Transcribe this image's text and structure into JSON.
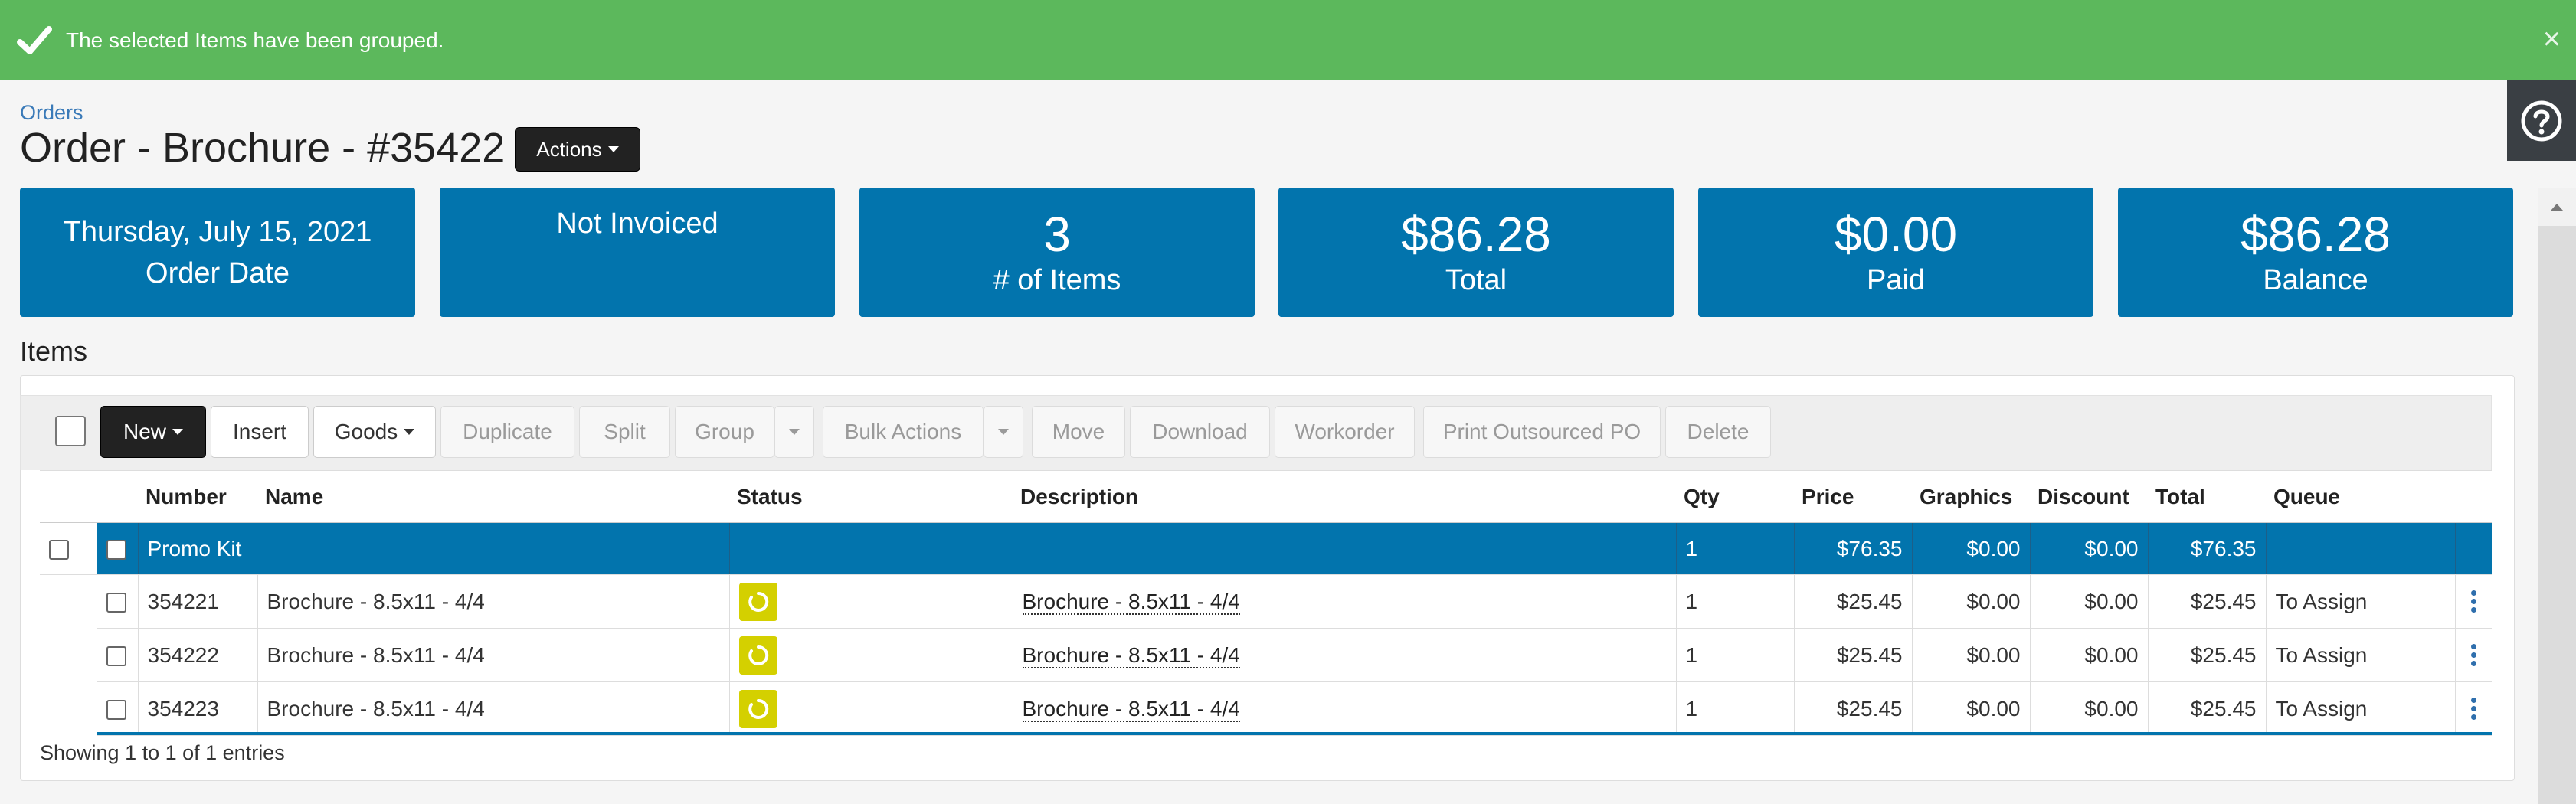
{
  "alert": {
    "message": "The selected Items have been grouped.",
    "close": "×"
  },
  "breadcrumb": "Orders",
  "title": "Order - Brochure - #35422",
  "actions_label": "Actions",
  "cards": [
    {
      "line1": "Thursday, July 15, 2021",
      "line2": "Order Date"
    },
    {
      "line1": "Not Invoiced"
    },
    {
      "value": "3",
      "label": "# of Items"
    },
    {
      "value": "$86.28",
      "label": "Total"
    },
    {
      "value": "$0.00",
      "label": "Paid"
    },
    {
      "value": "$86.28",
      "label": "Balance"
    }
  ],
  "items_title": "Items",
  "toolbar": {
    "new": "New",
    "insert": "Insert",
    "goods": "Goods",
    "duplicate": "Duplicate",
    "split": "Split",
    "group": "Group",
    "bulk_actions": "Bulk Actions",
    "move": "Move",
    "download": "Download",
    "workorder": "Workorder",
    "print_po": "Print Outsourced PO",
    "delete": "Delete"
  },
  "columns": {
    "number": "Number",
    "name": "Name",
    "status": "Status",
    "description": "Description",
    "qty": "Qty",
    "price": "Price",
    "graphics": "Graphics",
    "discount": "Discount",
    "total": "Total",
    "queue": "Queue"
  },
  "group_row": {
    "name": "Promo Kit",
    "qty": "1",
    "price": "$76.35",
    "graphics": "$0.00",
    "discount": "$0.00",
    "total": "$76.35"
  },
  "rows": [
    {
      "number": "354221",
      "name": "Brochure - 8.5x11 - 4/4",
      "description": "Brochure - 8.5x11 - 4/4",
      "qty": "1",
      "price": "$25.45",
      "graphics": "$0.00",
      "discount": "$0.00",
      "total": "$25.45",
      "queue": "To Assign"
    },
    {
      "number": "354222",
      "name": "Brochure - 8.5x11 - 4/4",
      "description": "Brochure - 8.5x11 - 4/4",
      "qty": "1",
      "price": "$25.45",
      "graphics": "$0.00",
      "discount": "$0.00",
      "total": "$25.45",
      "queue": "To Assign"
    },
    {
      "number": "354223",
      "name": "Brochure - 8.5x11 - 4/4",
      "description": "Brochure - 8.5x11 - 4/4",
      "qty": "1",
      "price": "$25.45",
      "graphics": "$0.00",
      "discount": "$0.00",
      "total": "$25.45",
      "queue": "To Assign"
    }
  ],
  "footer": "Showing 1 to 1 of 1 entries",
  "colors": {
    "success": "#5cb85c",
    "primary": "#0274ad",
    "status_yellow": "#d4d000"
  },
  "icons": {
    "alert": "check-icon",
    "help": "question-circle-icon",
    "row_menu": "kebab-icon",
    "status": "circle-notch-icon"
  }
}
